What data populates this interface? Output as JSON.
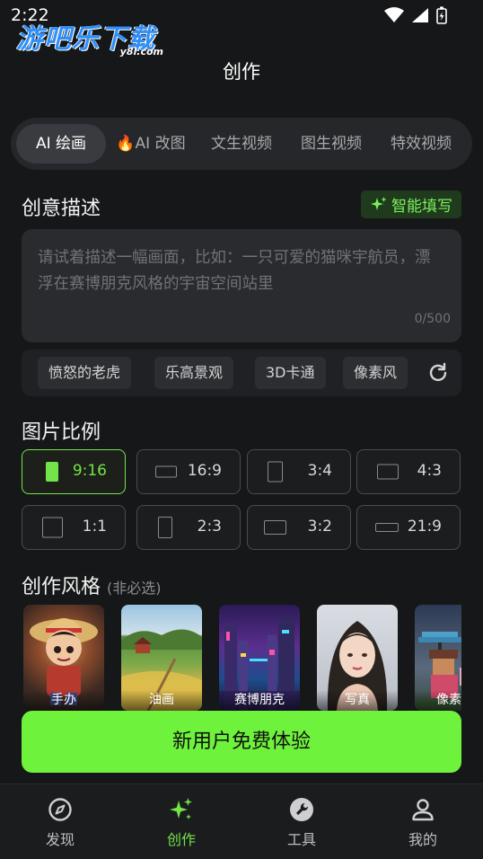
{
  "status_bar": {
    "time": "2:22"
  },
  "watermark": {
    "main": "游吧乐下载",
    "sub": "y8l.com"
  },
  "page": {
    "title": "创作"
  },
  "tabs": [
    {
      "label": "AI 绘画",
      "active": true
    },
    {
      "label": "🔥AI 改图",
      "active": false
    },
    {
      "label": "文生视频",
      "active": false
    },
    {
      "label": "图生视频",
      "active": false
    },
    {
      "label": "特效视频",
      "active": false
    }
  ],
  "description": {
    "title": "创意描述",
    "smart_fill_label": "智能填写",
    "placeholder": "请试着描述一幅画面，比如：一只可爱的猫咪宇航员，漂浮在赛博朋克风格的宇宙空间站里",
    "counter": "0/500"
  },
  "suggestions": [
    "愤怒的老虎",
    "乐高景观",
    "3D卡通",
    "像素风"
  ],
  "ratio": {
    "title": "图片比例",
    "options": [
      {
        "label": "9:16",
        "selected": true
      },
      {
        "label": "16:9",
        "selected": false
      },
      {
        "label": "3:4",
        "selected": false
      },
      {
        "label": "4:3",
        "selected": false
      },
      {
        "label": "1:1",
        "selected": false
      },
      {
        "label": "2:3",
        "selected": false
      },
      {
        "label": "3:2",
        "selected": false
      },
      {
        "label": "21:9",
        "selected": false
      }
    ]
  },
  "style": {
    "title": "创作风格",
    "note": "(非必选)",
    "items": [
      "手办",
      "油画",
      "赛博朋克",
      "写真",
      "像素风"
    ]
  },
  "cta": {
    "label": "新用户免费体验"
  },
  "bottom_nav": [
    {
      "label": "发现",
      "icon": "compass-icon",
      "active": false
    },
    {
      "label": "创作",
      "icon": "sparkles-icon",
      "active": true
    },
    {
      "label": "工具",
      "icon": "wrench-icon",
      "active": false
    },
    {
      "label": "我的",
      "icon": "person-icon",
      "active": false
    }
  ],
  "colors": {
    "accent": "#6ef23c",
    "background": "#161718",
    "surface": "#26272a"
  }
}
